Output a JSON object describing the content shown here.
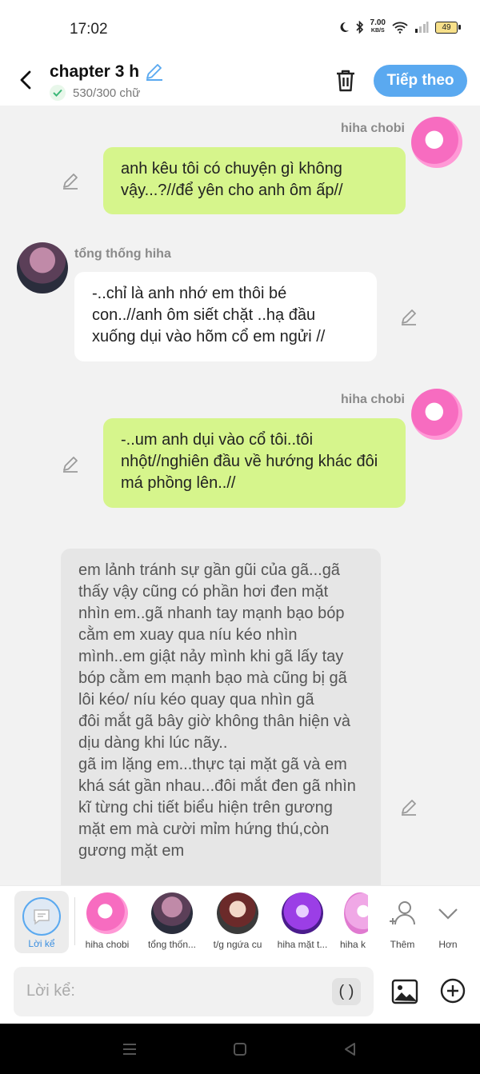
{
  "status_bar": {
    "time": "17:02",
    "net_speed_top": "7.00",
    "net_speed_unit": "KB/S",
    "battery": "49"
  },
  "header": {
    "title": "chapter 3 h",
    "char_count": "530/300 chữ",
    "next_label": "Tiếp theo"
  },
  "messages": [
    {
      "sender": "hiha chobi",
      "side": "right",
      "text": "anh kêu tôi có chuyện gì không vậy...?//để yên cho anh ôm ấp//"
    },
    {
      "sender": "tổng thống hiha",
      "side": "left",
      "text": "-..chỉ là anh nhớ em thôi bé con..//anh ôm siết chặt ..hạ đầu xuống dụi vào hõm cổ em ngửi //"
    },
    {
      "sender": "hiha chobi",
      "side": "right",
      "text": "-..um anh dụi vào cổ tôi..tôi nhột//nghiên đầu về hướng khác đôi má phồng lên..//"
    },
    {
      "sender": "",
      "side": "narration",
      "text": "em lảnh tránh sự gần gũi của gã...gã thấy vậy cũng có phần hơi đen mặt nhìn em..gã nhanh tay mạnh bạo bóp cằm em xuay qua níu kéo nhìn mình..em giật nảy mình khi gã lấy tay bóp cằm em mạnh bạo mà cũng bị gã lôi kéo/ níu kéo quay qua nhìn gã\nđôi mắt gã bây giờ không thân hiện và dịu dàng khi lúc nãy..\ngã im lặng em...thực tại mặt gã và em khá sát gần nhau...đôi mắt đen gã nhìn kĩ từng chi tiết biểu hiện trên gương mặt em mà cười mỉm hứng thú,còn gương mặt em"
    }
  ],
  "characters": {
    "narrator_label": "Lời kể",
    "items": [
      {
        "name": "hiha chobi"
      },
      {
        "name": "tổng thốn..."
      },
      {
        "name": "t/g ngứa cu"
      },
      {
        "name": "hiha mặt t..."
      },
      {
        "name": "hiha k"
      }
    ],
    "add_label": "Thêm",
    "more_label": "Hơn"
  },
  "input": {
    "placeholder": "Lời kể:",
    "paren_label": "( )"
  }
}
